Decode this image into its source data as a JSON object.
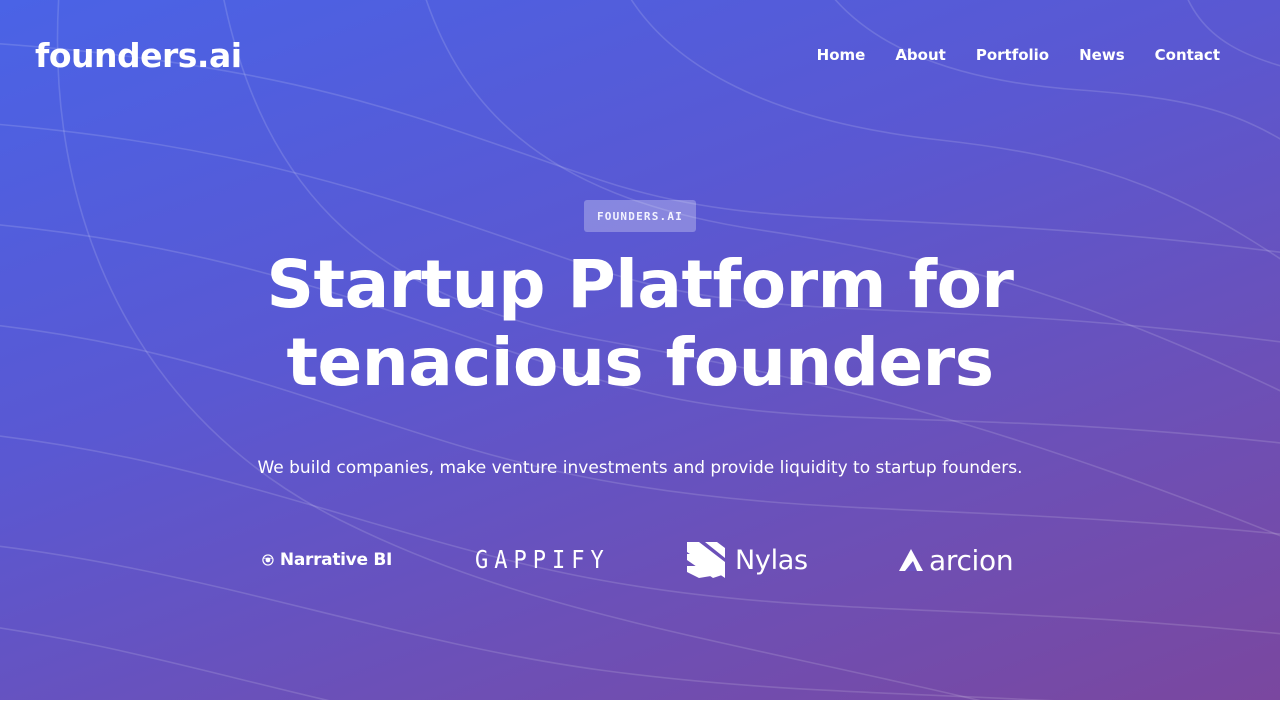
{
  "brand": {
    "logo_text": "founders.ai"
  },
  "nav": {
    "items": [
      {
        "label": "Home"
      },
      {
        "label": "About"
      },
      {
        "label": "Portfolio"
      },
      {
        "label": "News"
      },
      {
        "label": "Contact"
      }
    ]
  },
  "hero": {
    "badge": "FOUNDERS.AI",
    "headline_line1": "Startup Platform for",
    "headline_line2": "tenacious founders",
    "subtitle": "We build companies, make venture investments and provide liquidity to startup founders."
  },
  "partners": [
    {
      "name": "Narrative BI",
      "icon": "narrative-bi-logo-icon"
    },
    {
      "name": "GAPPIFY",
      "icon": "gappify-logo"
    },
    {
      "name": "Nylas",
      "icon": "nylas-logo-icon"
    },
    {
      "name": "arcion",
      "icon": "arcion-logo-icon"
    }
  ],
  "colors": {
    "gradient_start": "#4a63e6",
    "gradient_end": "#7a479f",
    "text": "#ffffff"
  }
}
